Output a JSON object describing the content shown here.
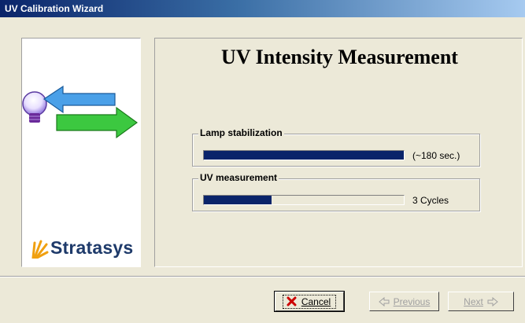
{
  "window": {
    "title": "UV Calibration Wizard"
  },
  "brand": {
    "name": "Stratasys"
  },
  "main": {
    "heading": "UV Intensity Measurement",
    "groups": [
      {
        "label": "Lamp stabilization",
        "note": "(~180 sec.)",
        "progress": 1.0
      },
      {
        "label": "UV measurement",
        "note": "3 Cycles",
        "progress": 0.34
      }
    ]
  },
  "buttons": {
    "cancel": {
      "label": "Cancel",
      "icon": "red-x-icon",
      "enabled": true
    },
    "previous": {
      "label": "Previous",
      "icon": "arrow-left-icon",
      "enabled": false
    },
    "next": {
      "label": "Next",
      "icon": "arrow-right-icon",
      "enabled": false
    }
  },
  "colors": {
    "progress": "#0a246a",
    "cancel_icon": "#cc0000",
    "brand_text": "#1e3a6a",
    "brand_mark": "#f0a010"
  }
}
